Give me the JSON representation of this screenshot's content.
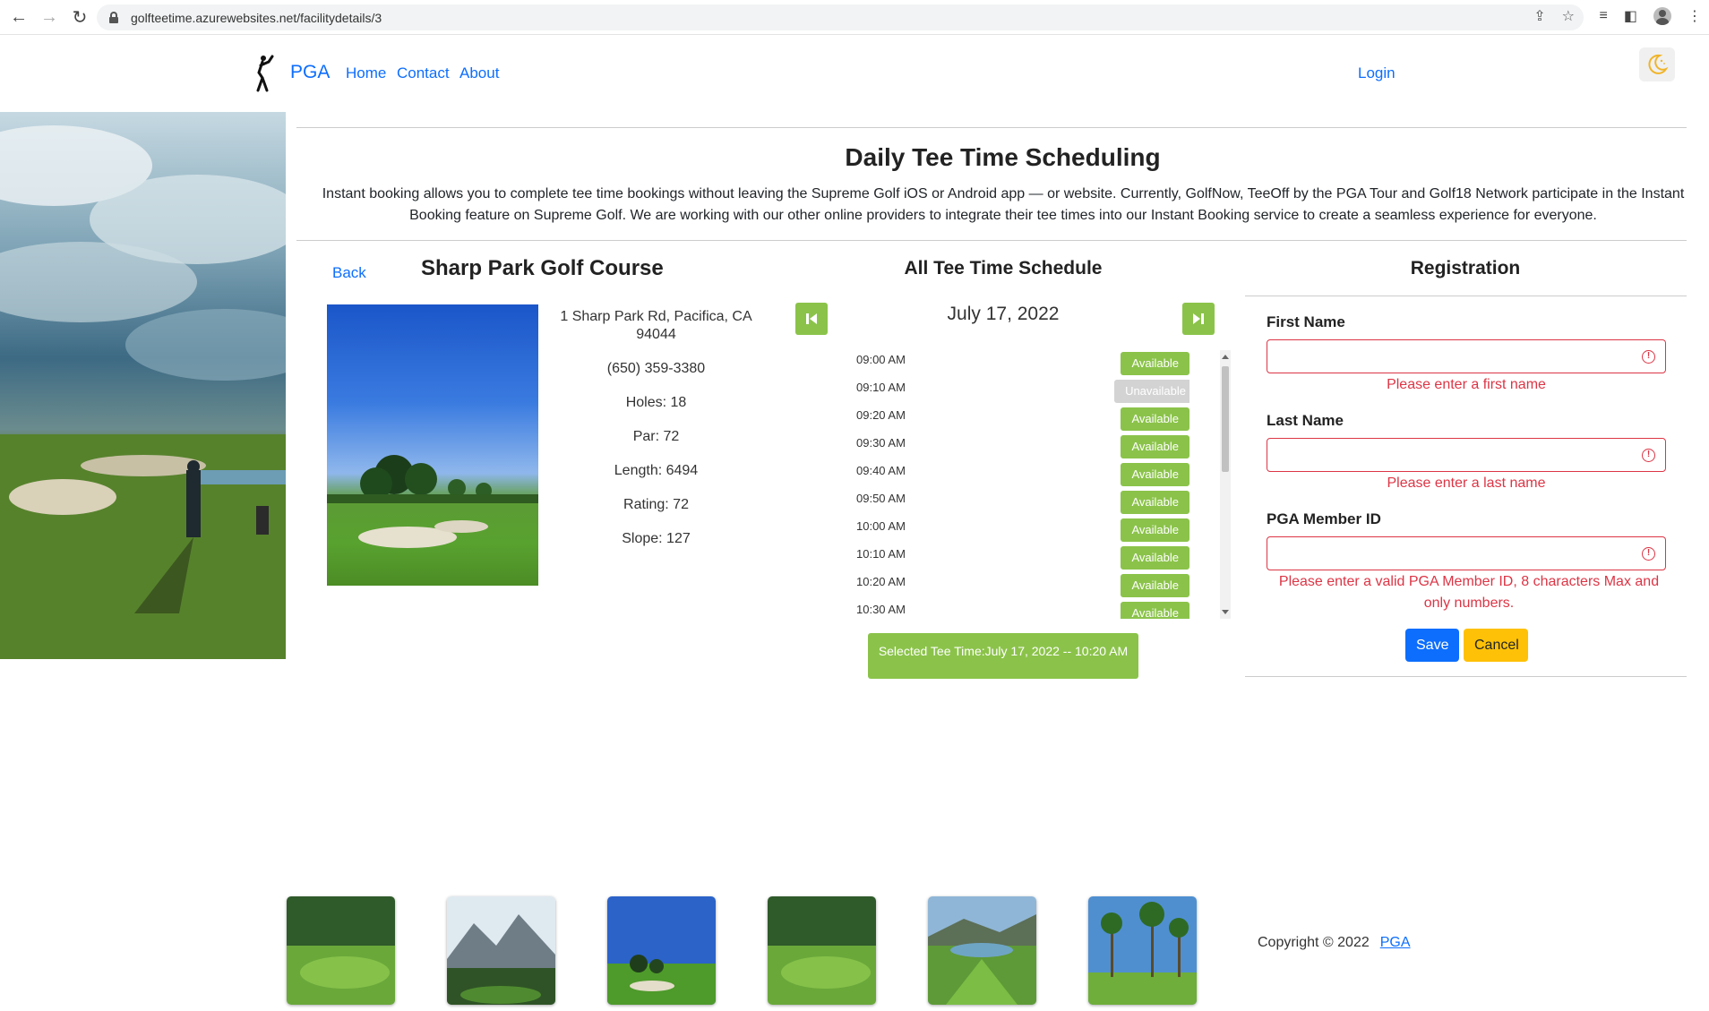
{
  "browser": {
    "url": "golfteetime.azurewebsites.net/facilitydetails/3"
  },
  "nav": {
    "brand": "PGA",
    "links": [
      "Home",
      "Contact",
      "About"
    ],
    "login": "Login"
  },
  "header": {
    "title": "Daily Tee Time Scheduling",
    "intro": "Instant booking allows you to complete tee time bookings without leaving the Supreme Golf iOS or Android app — or website. Currently, GolfNow, TeeOff by the PGA Tour and Golf18 Network participate in the Instant Booking feature on Supreme Golf. We are working with our other online providers to integrate their tee times into our Instant Booking service to create a seamless experience for everyone."
  },
  "course": {
    "back_label": "Back",
    "name": "Sharp Park Golf Course",
    "address": "1 Sharp Park Rd, Pacifica, CA 94044",
    "phone": "(650) 359-3380",
    "holes": "Holes: 18",
    "par": "Par: 72",
    "length": "Length: 6494",
    "rating": "Rating: 72",
    "slope": "Slope: 127"
  },
  "schedule": {
    "title": "All Tee Time Schedule",
    "date": "July 17, 2022",
    "slots": [
      {
        "time": "09:00 AM",
        "status": "Available"
      },
      {
        "time": "09:10 AM",
        "status": "Unavailable"
      },
      {
        "time": "09:20 AM",
        "status": "Available"
      },
      {
        "time": "09:30 AM",
        "status": "Available"
      },
      {
        "time": "09:40 AM",
        "status": "Available"
      },
      {
        "time": "09:50 AM",
        "status": "Available"
      },
      {
        "time": "10:00 AM",
        "status": "Available"
      },
      {
        "time": "10:10 AM",
        "status": "Available"
      },
      {
        "time": "10:20 AM",
        "status": "Available"
      },
      {
        "time": "10:30 AM",
        "status": "Available"
      }
    ],
    "selected": "Selected Tee Time:July 17, 2022 -- 10:20 AM"
  },
  "registration": {
    "title": "Registration",
    "first_name_label": "First Name",
    "first_name_value": "",
    "first_name_error": "Please enter a first name",
    "last_name_label": "Last Name",
    "last_name_value": "",
    "last_name_error": "Please enter a last name",
    "member_id_label": "PGA Member ID",
    "member_id_value": "",
    "member_id_error": "Please enter a valid PGA Member ID, 8 characters Max and only numbers.",
    "save_label": "Save",
    "cancel_label": "Cancel"
  },
  "footer": {
    "copyright": "Copyright © 2022",
    "link": "PGA"
  },
  "colors": {
    "primary": "#0d6efd",
    "available": "#8bc34a",
    "unavailable": "#d3d3d3",
    "danger": "#dc3545",
    "warning": "#ffc107"
  }
}
